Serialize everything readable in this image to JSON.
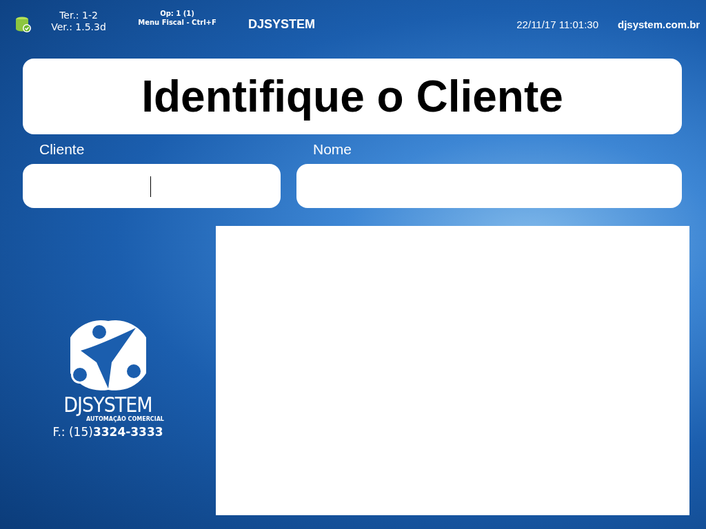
{
  "header": {
    "terminal": "Ter.: 1-2",
    "version": "Ver.: 1.5.3d",
    "operator": "Op: 1 (1)",
    "shortcut": "Menu Fiscal - Ctrl+F",
    "brand": "DJSYSTEM",
    "datetime": "22/11/17 11:01:30",
    "website": "djsystem.com.br"
  },
  "title": "Identifique o Cliente",
  "fields": [
    {
      "label": "Cliente",
      "focused": true
    },
    {
      "label": "Nome",
      "focused": false
    }
  ],
  "logo": {
    "name": "DJSYSTEM",
    "tagline": "AUTOMAÇÃO COMERCIAL",
    "phone": "F.: (15)**3324-3333**"
  }
}
